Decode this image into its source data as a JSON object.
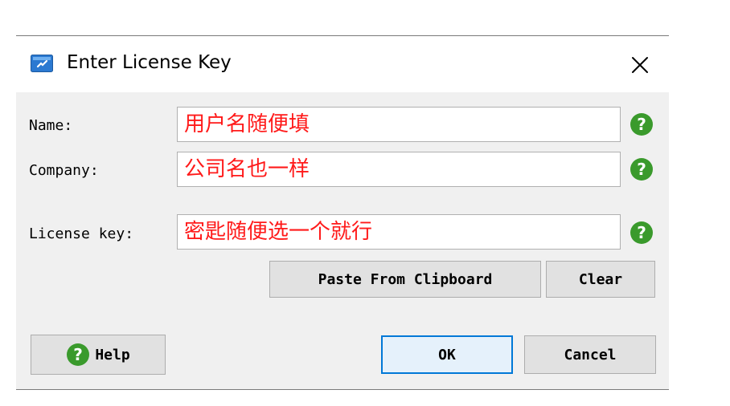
{
  "dialog": {
    "title": "Enter License Key",
    "close_glyph": "✕"
  },
  "fields": {
    "name": {
      "label": "Name:",
      "value": "用户名随便填"
    },
    "company": {
      "label": "Company:",
      "value": "公司名也一样"
    },
    "license_key": {
      "label": "License key:",
      "value": "密匙随便选一个就行"
    }
  },
  "buttons": {
    "paste": "Paste From Clipboard",
    "clear": "Clear",
    "help": "Help",
    "ok": "OK",
    "cancel": "Cancel"
  },
  "icons": {
    "app": "license-app-icon",
    "help": "question-mark-icon",
    "close": "close-icon"
  },
  "colors": {
    "help_green": "#3a9a2c",
    "input_text_red": "#ff1a1a",
    "primary_border": "#0078d7",
    "app_icon_blue": "#2b79d1"
  }
}
